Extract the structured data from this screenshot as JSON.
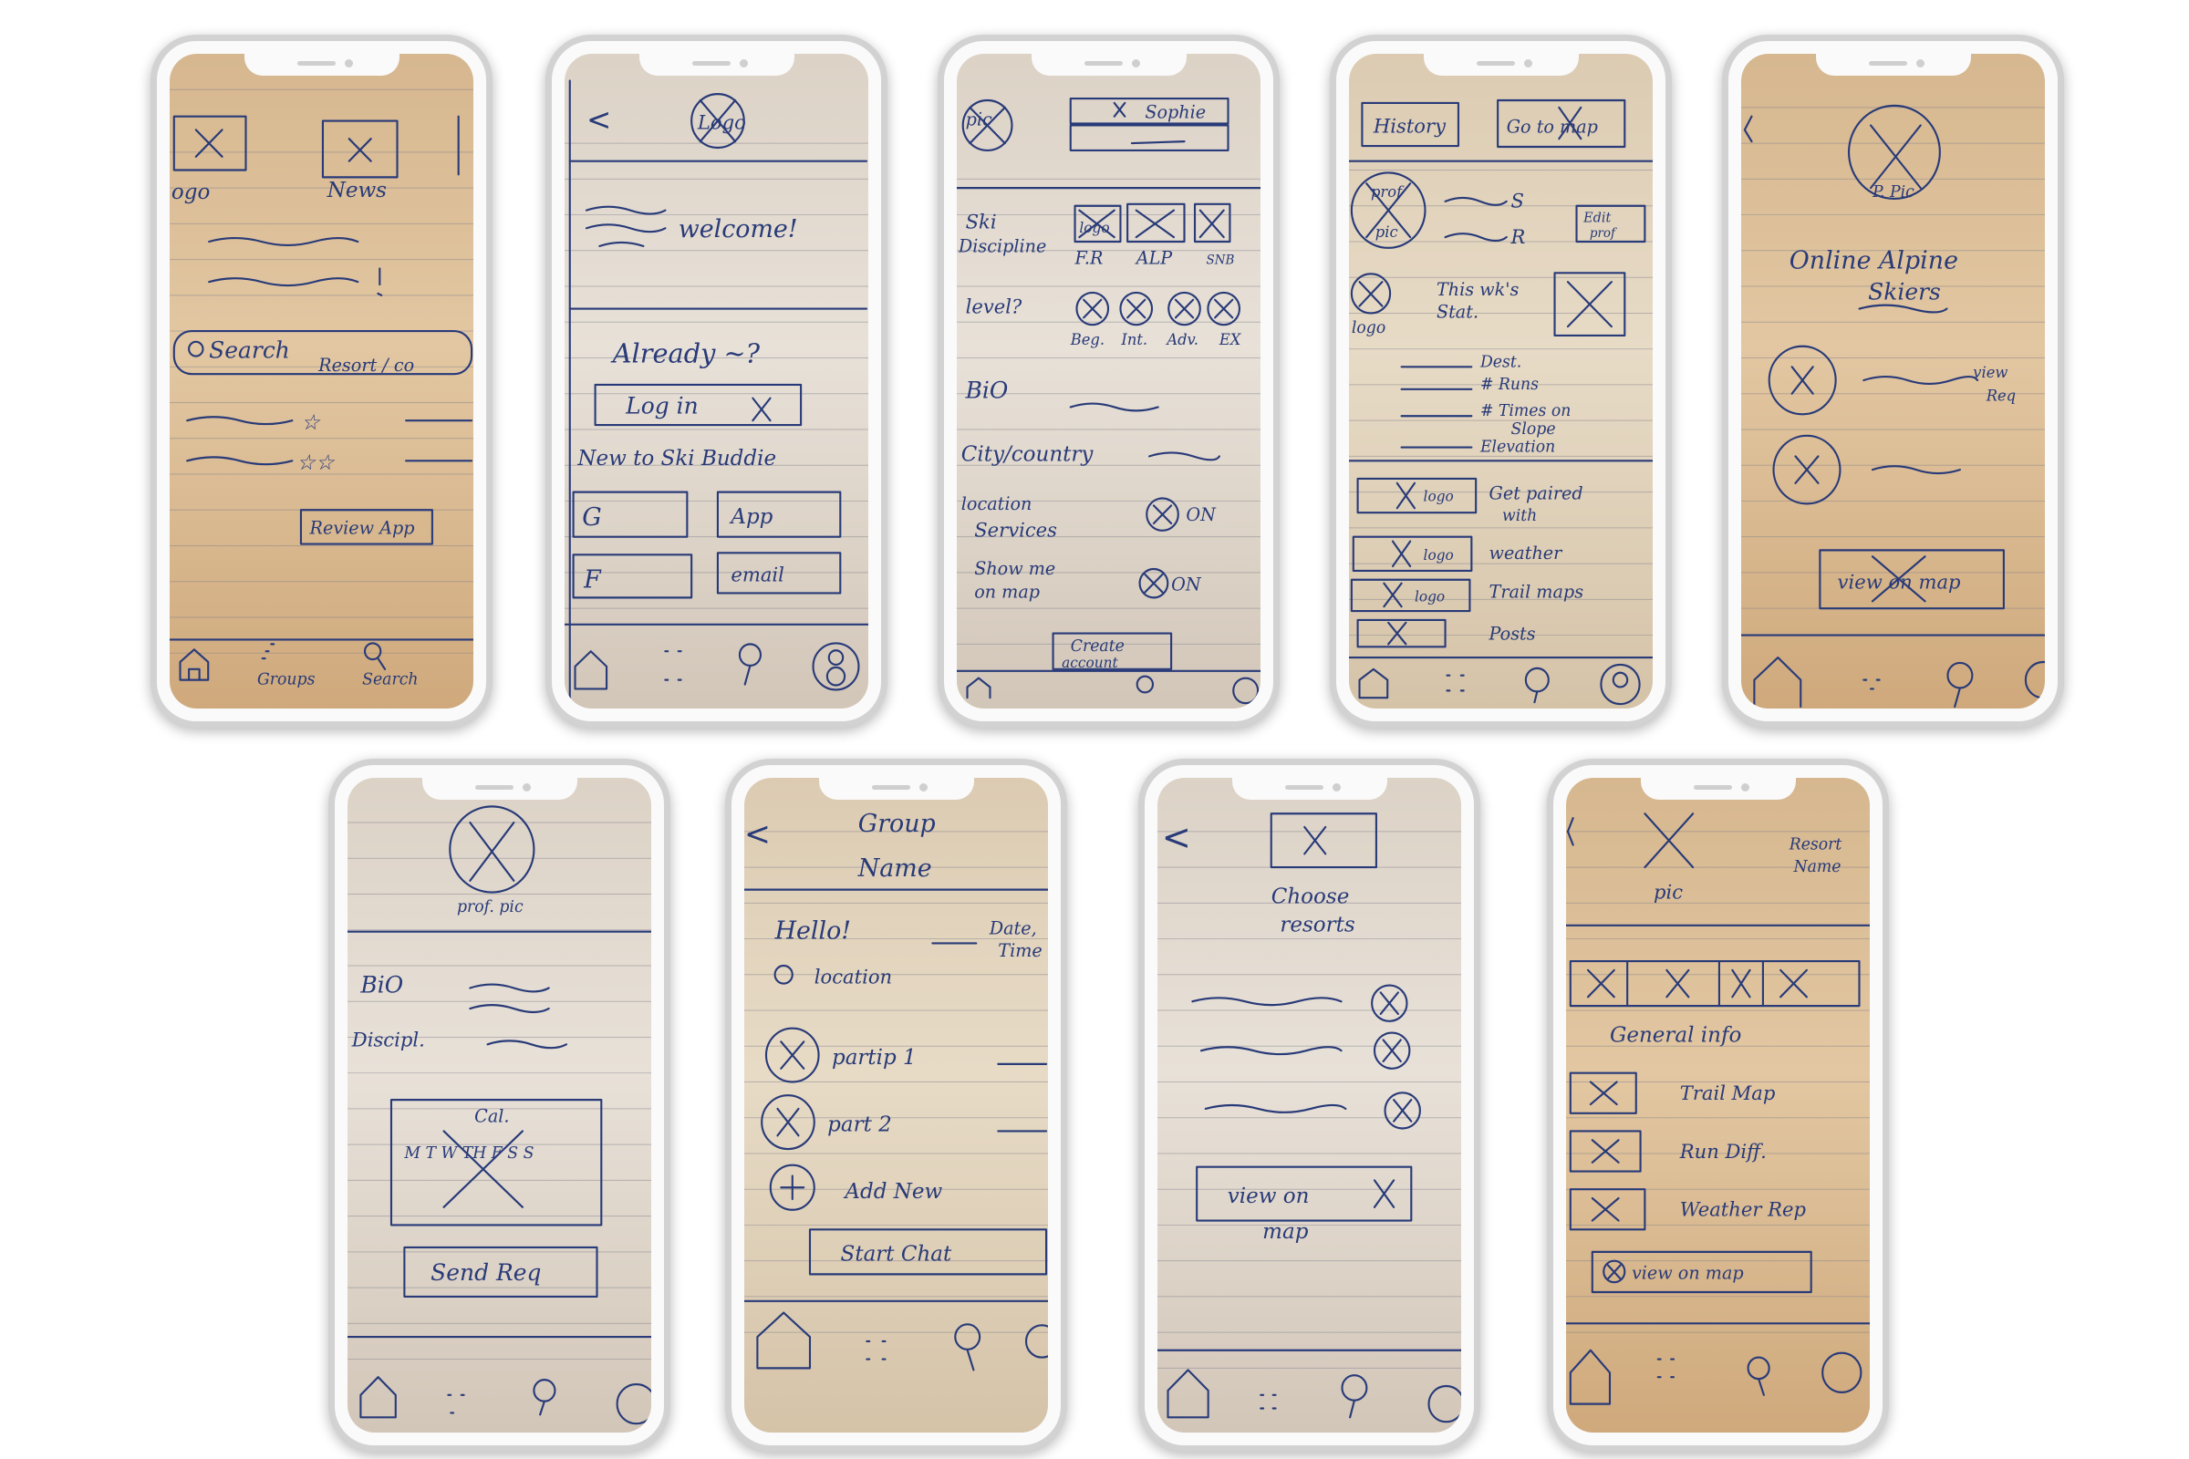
{
  "s1": {
    "logo": "ogo",
    "news": "News",
    "search": "Search",
    "resort": "Resort / co",
    "review": "Review App",
    "groups": "Groups",
    "search_tab": "Search"
  },
  "s2": {
    "back": "<",
    "logo": "Logo",
    "welcome": "welcome!",
    "already": "Already ~?",
    "login": "Log in",
    "new_to": "New to Ski Buddie",
    "g": "G",
    "app": "App",
    "f": "F",
    "email": "email"
  },
  "s3": {
    "pic": "pic",
    "sophie": "Sophie",
    "ski": "Ski",
    "discipline": "Discipline",
    "logo": "logo",
    "fr": "F.R",
    "alp": "ALP",
    "snb": "SNB",
    "level": "level?",
    "beg": "Beg.",
    "int": "Int.",
    "adv": "Adv.",
    "ex": "EX",
    "bio": "BiO",
    "city": "City/country",
    "location": "location",
    "services": "Services",
    "on1": "ON",
    "show_me": "Show me",
    "on_map": "on map",
    "on2": "ON",
    "create": "Create",
    "account": "account"
  },
  "s4": {
    "history": "History",
    "go_to_map": "Go to map",
    "prof": "prof",
    "pic": "pic",
    "s": "S",
    "r": "R",
    "edit": "Edit",
    "prof2": "prof",
    "logo": "logo",
    "this_wk": "This wk's",
    "stat": "Stat.",
    "dest": "Dest.",
    "runs": "# Runs",
    "times": "# Times on",
    "slope": "Slope",
    "elevation": "Elevation",
    "get_paired": "Get paired",
    "with": "with",
    "weather": "weather",
    "trail_maps": "Trail maps",
    "posts": "Posts"
  },
  "s5": {
    "p_pic": "P. Pic",
    "online": "Online Alpine",
    "skiers": "Skiers",
    "view": "view",
    "req": "Req",
    "view_on_map": "view on map"
  },
  "s6": {
    "prof_pic": "prof. pic",
    "bio": "BiO",
    "discipl": "Discipl.",
    "cal": "Cal.",
    "days": "M T W TH F S S",
    "send": "Send Req"
  },
  "s7": {
    "back": "<",
    "group": "Group",
    "name": "Name",
    "hello": "Hello!",
    "date": "Date,",
    "time": "Time",
    "location": "location",
    "p1": "partip 1",
    "p2": "part 2",
    "add": "Add New",
    "start": "Start Chat"
  },
  "s8": {
    "back": "<",
    "choose": "Choose",
    "resorts": "resorts",
    "view_on": "view on",
    "map": "map"
  },
  "s9": {
    "pic": "pic",
    "resort": "Resort",
    "name": "Name",
    "general": "General info",
    "trail": "Trail Map",
    "run": "Run Diff.",
    "weather": "Weather Rep",
    "view": "view on map"
  }
}
